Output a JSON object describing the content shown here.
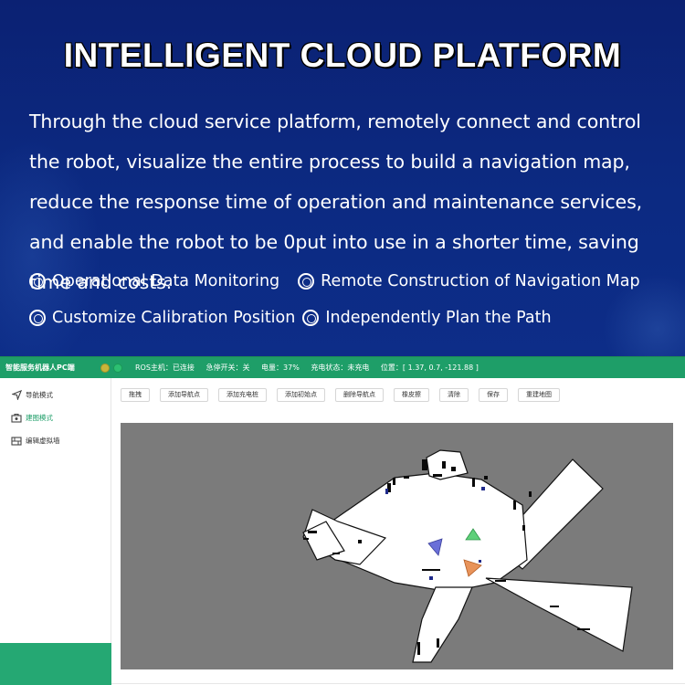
{
  "hero": {
    "title": "INTELLIGENT CLOUD PLATFORM",
    "description": "Through the cloud service platform, remotely connect and control the robot, visualize the entire process to build a navigation map, reduce the response time of operation and maintenance services, and enable the robot to be 0put into use in a shorter time, saving time and costs.",
    "features": [
      "Operational Data Monitoring",
      "Remote Construction of Navigation Map",
      "Customize Calibration Position",
      "Independently Plan the Path"
    ]
  },
  "app": {
    "name": "智能服务机器人PC端",
    "status": {
      "ros": "ROS主机：已连接",
      "estop": "急停开关：关",
      "battery": "电量：37%",
      "charging": "充电状态：未充电",
      "position": "位置：[ 1.37, 0.7, -121.88 ]"
    },
    "sidebar": [
      {
        "label": "导航模式",
        "icon": "navigation-arrow-icon"
      },
      {
        "label": "建图模式",
        "icon": "map-build-icon"
      },
      {
        "label": "编辑虚拟墙",
        "icon": "virtual-wall-icon"
      }
    ],
    "toolbar": [
      "拖拽",
      "添加导航点",
      "添加充电桩",
      "添加初始点",
      "删除导航点",
      "橡皮擦",
      "清除",
      "保存",
      "重建地图"
    ],
    "colors": {
      "topbar": "#1e9e68",
      "map_background": "#7b7b7b",
      "map_free_space": "#ffffff",
      "obstacle": "#0a0a0a",
      "robot_blue": "#6a6fd8",
      "robot_green": "#5fd07a",
      "robot_orange": "#e8935a"
    }
  }
}
